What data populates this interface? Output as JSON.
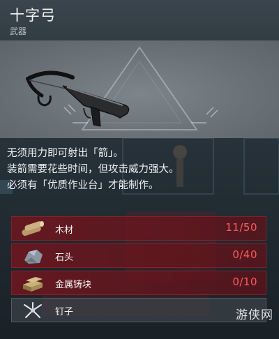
{
  "item": {
    "title": "十字弓",
    "category": "武器",
    "icon": "crossbow-icon"
  },
  "description": [
    "无须用力即可射出「箭」。",
    "装箭需要花些时间，但攻击威力强大。",
    "必须有「优质作业台」才能制作。"
  ],
  "materials": [
    {
      "name": "木材",
      "count": "11/50",
      "icon": "wood-logs-icon"
    },
    {
      "name": "石头",
      "count": "0/40",
      "icon": "stone-icon"
    },
    {
      "name": "金属铸块",
      "count": "0/10",
      "icon": "metal-ingot-icon"
    },
    {
      "name": "钉子",
      "count": "",
      "icon": "nails-icon"
    }
  ],
  "watermark": "游侠网",
  "colors": {
    "insufficient": "#ff5a5a",
    "row_red": "#78141c",
    "header_bg": "#3a454d"
  }
}
